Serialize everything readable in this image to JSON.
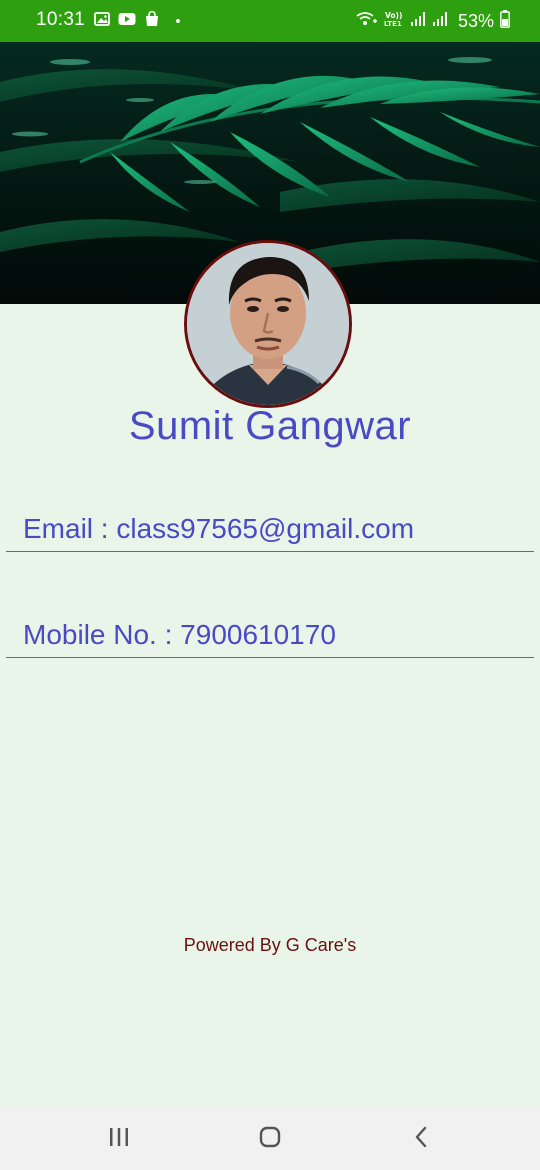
{
  "status_bar": {
    "time": "10:31",
    "battery": "53%",
    "icons": [
      "gallery-icon",
      "youtube-icon",
      "shopping-bag-icon",
      "wifi-calling-icon",
      "volte-icon",
      "signal-icon",
      "signal-icon-2",
      "battery-icon"
    ]
  },
  "profile": {
    "name": "Sumit Gangwar",
    "email_line": "Email : class97565@gmail.com",
    "mobile_line": "Mobile No. : 7900610170"
  },
  "footer": {
    "powered_by": "Powered By G Care's"
  },
  "nav": {
    "items": [
      "recents-icon",
      "home-icon",
      "back-icon"
    ]
  },
  "colors": {
    "status_bar": "#2e9f0e",
    "background": "#e8f5e8",
    "accent_text": "#4a4ac4",
    "avatar_border": "#6a0d0d",
    "footer_text": "#6b1010"
  }
}
